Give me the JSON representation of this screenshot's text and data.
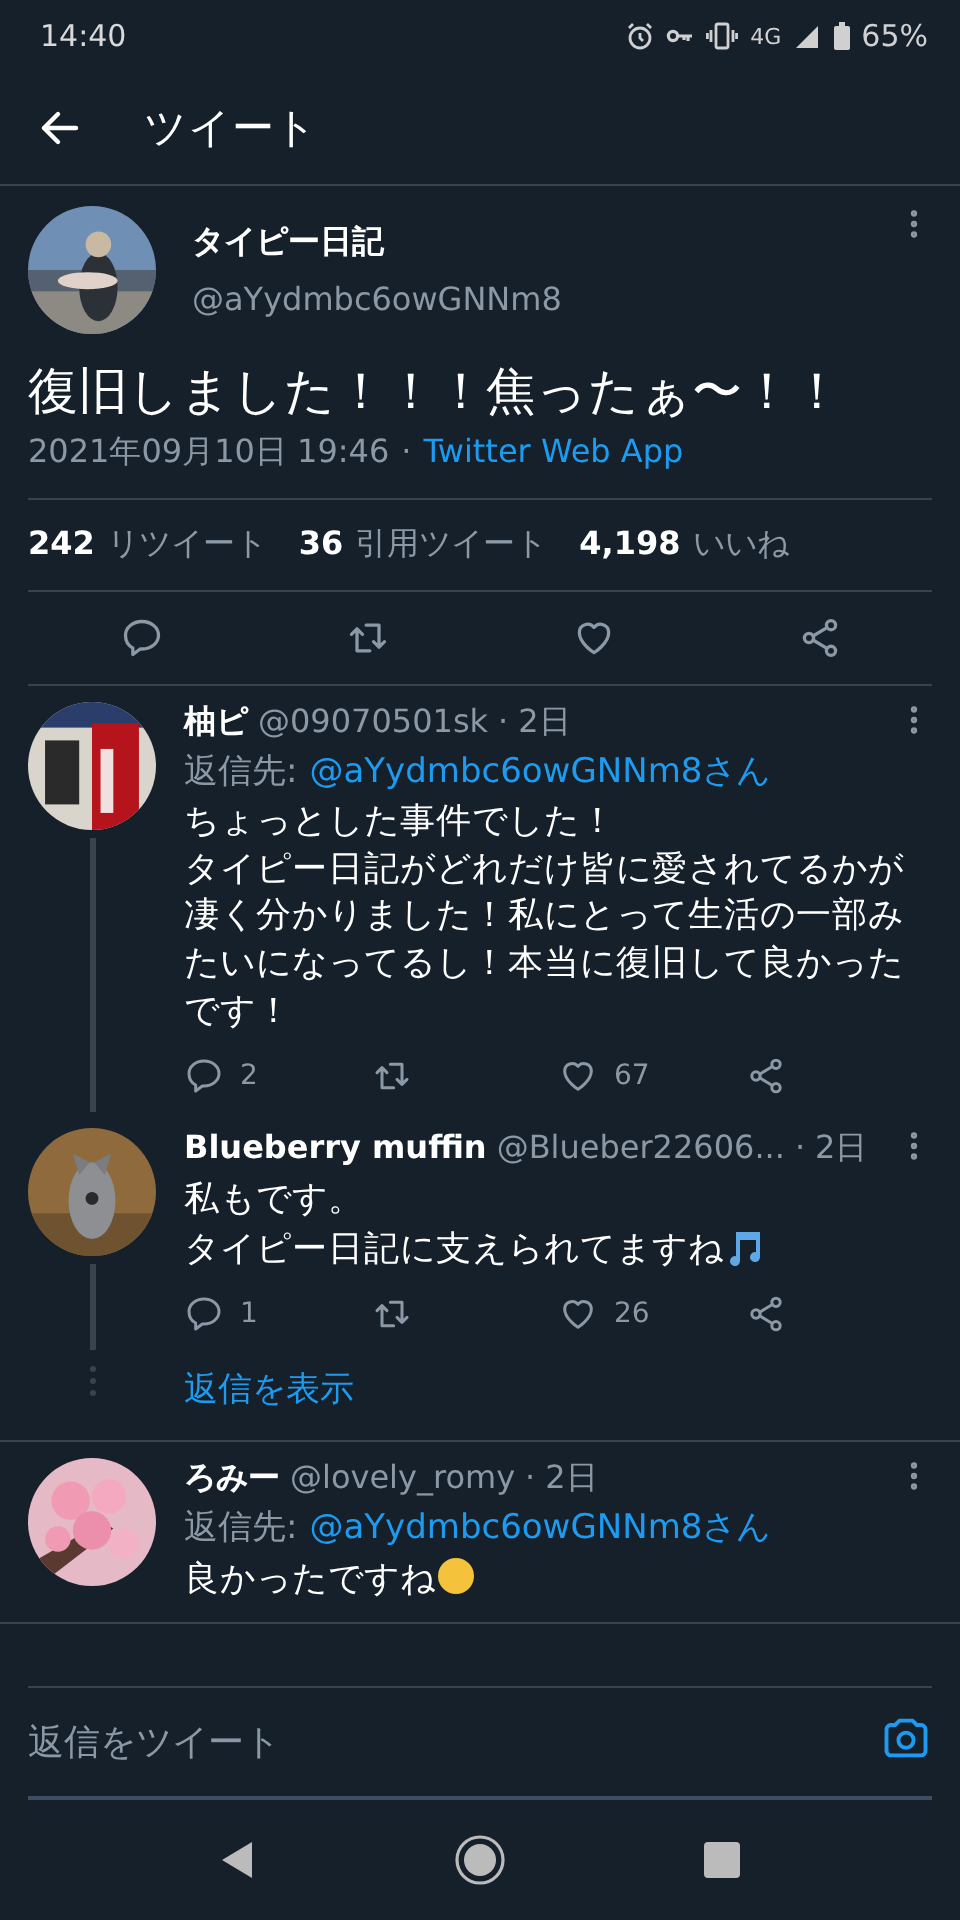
{
  "status_bar": {
    "time": "14:40",
    "network": "4G",
    "battery": "65%"
  },
  "header": {
    "title": "ツイート"
  },
  "tweet": {
    "name": "タイピー日記",
    "handle": "@aYydmbc6owGNNm8",
    "text": "復旧しました！！！焦ったぁ〜！！",
    "timestamp": "2021年09月10日 19:46",
    "separator": "·",
    "source": "Twitter Web App",
    "stats": [
      {
        "count": "242",
        "label": "リツイート"
      },
      {
        "count": "36",
        "label": "引用ツイート"
      },
      {
        "count": "4,198",
        "label": "いいね"
      }
    ]
  },
  "replies": [
    {
      "name": "柚ピ",
      "handle": "@09070501sk",
      "dot": "·",
      "time": "2日",
      "reply_to_label": "返信先:",
      "reply_to": "@aYydmbc6owGNNm8さん",
      "lines": [
        "ちょっとした事件でした！",
        "タイピー日記がどれだけ皆に愛されてるかが凄く分かりました！私にとって生活の一部みたいになってるし！本当に復旧して良かったです！"
      ],
      "reply_count": "2",
      "like_count": "67",
      "thread_line": true
    },
    {
      "name": "Blueberry muffin",
      "handle": "@Blueber22606...",
      "dot": "·",
      "time": "2日",
      "lines": [
        "私もです。",
        "タイピー日記に支えられてますね"
      ],
      "music_icon": true,
      "reply_count": "1",
      "like_count": "26",
      "thread_line": true,
      "show_replies": "返信を表示"
    },
    {
      "name": "ろみー",
      "handle": "@lovely_romy",
      "dot": "·",
      "time": "2日",
      "reply_to_label": "返信先:",
      "reply_to": "@aYydmbc6owGNNm8さん",
      "lines": [
        "良かったですね"
      ],
      "emoji_icon": true,
      "thread_line": false
    }
  ],
  "compose": {
    "placeholder": "返信をツイート"
  }
}
